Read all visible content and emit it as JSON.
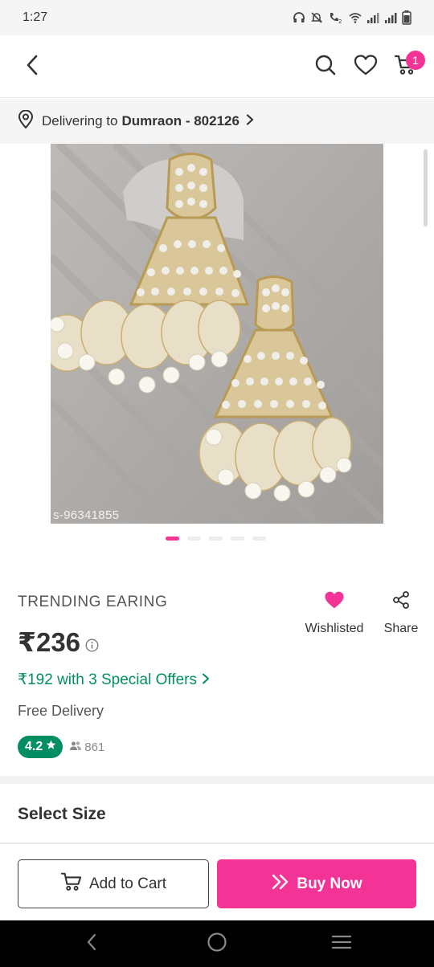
{
  "status_bar": {
    "time": "1:27",
    "icons": [
      "headphones-icon",
      "bell-muted-icon",
      "call-icon",
      "wifi-icon",
      "signal-icon",
      "signal-icon",
      "battery-icon"
    ]
  },
  "header": {
    "icons": [
      "back-arrow-icon",
      "search-icon",
      "heart-icon",
      "cart-icon"
    ],
    "cart_count": "1"
  },
  "delivery": {
    "prefix": "Delivering to",
    "location": "Dumraon - 802126"
  },
  "product": {
    "image_code": "s-96341855",
    "carousel_count": 5,
    "carousel_active": 1,
    "title": "TRENDING EARING",
    "price": "₹236",
    "offer": "₹192 with 3 Special Offers",
    "delivery": "Free Delivery",
    "rating": "4.2",
    "review_count": "861"
  },
  "actions": {
    "wishlisted_label": "Wishlisted",
    "share_label": "Share"
  },
  "size_section": {
    "title": "Select Size"
  },
  "bottom_bar": {
    "add_to_cart": "Add to Cart",
    "buy_now": "Buy Now"
  },
  "colors": {
    "accent": "#f43397",
    "green": "#038d63",
    "text": "#333333"
  }
}
